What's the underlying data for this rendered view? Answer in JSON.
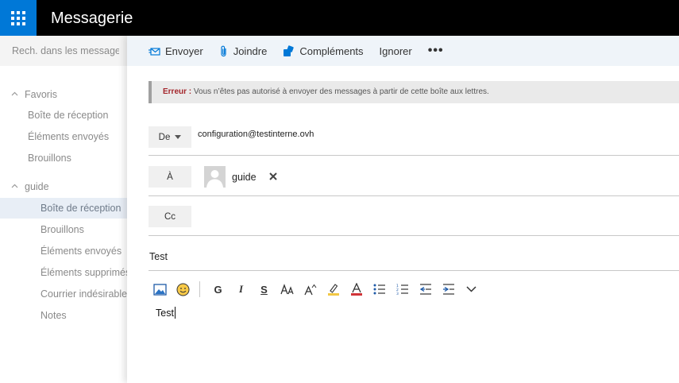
{
  "app": {
    "title": "Messagerie"
  },
  "search": {
    "placeholder": "Rech. dans les messages ..."
  },
  "nav": {
    "favorites_label": "Favoris",
    "favorites": [
      "Boîte de réception",
      "Éléments envoyés",
      "Brouillons"
    ],
    "account_label": "guide",
    "account_items": [
      "Boîte de réception",
      "Brouillons",
      "Éléments envoyés",
      "Éléments supprimés",
      "Courrier indésirable",
      "Notes"
    ],
    "selected": "Boîte de réception"
  },
  "toolbar": {
    "send_label": "Envoyer",
    "attach_label": "Joindre",
    "addins_label": "Compléments",
    "discard_label": "Ignorer",
    "more_label": "•••"
  },
  "error": {
    "label": "Erreur :",
    "message": " Vous n’êtes pas autorisé à envoyer des messages à partir de cette boîte aux lettres."
  },
  "compose": {
    "from_label": "De",
    "from_value": "configuration@testinterne.ovh",
    "to_label": "À",
    "to_recipient": "guide",
    "cc_label": "Cc",
    "subject": "Test",
    "body": "Test"
  },
  "format_toolbar": {
    "bold": "G",
    "italic": "I",
    "underline": "S"
  },
  "colors": {
    "accent": "#0078d7",
    "topbar": "#000000",
    "cmdbar": "#eff4f9",
    "error": "#a4262c",
    "selected": "#e8eef6"
  }
}
